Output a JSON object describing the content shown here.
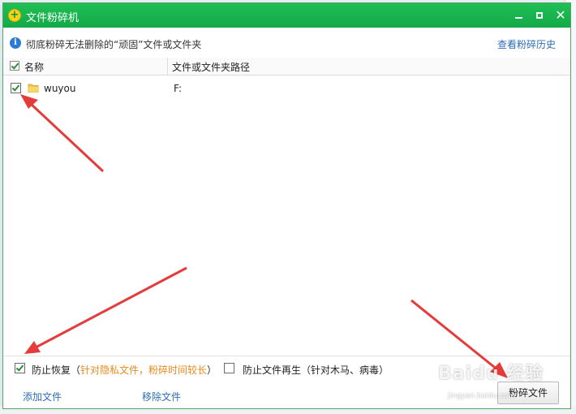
{
  "window": {
    "title": "文件粉碎机",
    "accent_color": "#18b44f",
    "logo_icon": "plus-coin-icon",
    "controls": [
      "minimize-icon",
      "maximize-icon",
      "close-icon"
    ]
  },
  "infobar": {
    "icon": "info-icon",
    "text": "彻底粉碎无法删除的“顽固”文件或文件夹",
    "history_link": "查看粉碎历史"
  },
  "list": {
    "columns": [
      "名称",
      "文件或文件夹路径"
    ],
    "header_checked": true,
    "rows": [
      {
        "checked": true,
        "icon": "folder-icon",
        "name": "wuyou",
        "path": "F:"
      }
    ]
  },
  "options": {
    "prevent_recovery": {
      "checked": true,
      "label": "防止恢复",
      "paren_open": "（",
      "note": "针对隐私文件，粉碎时间较长",
      "paren_close": "）"
    },
    "prevent_regen": {
      "checked": false,
      "label": "防止文件再生（针对木马、病毒）"
    }
  },
  "bottom": {
    "add_file": "添加文件",
    "remove_file": "移除文件",
    "shred_button": "粉碎文件"
  },
  "watermark": {
    "text": "Baidu 经验",
    "sub": "jingyan.baidu.com"
  },
  "colors": {
    "link": "#2d6db4",
    "note_orange": "#e88a1d",
    "annotation_red": "#e53b3b"
  }
}
